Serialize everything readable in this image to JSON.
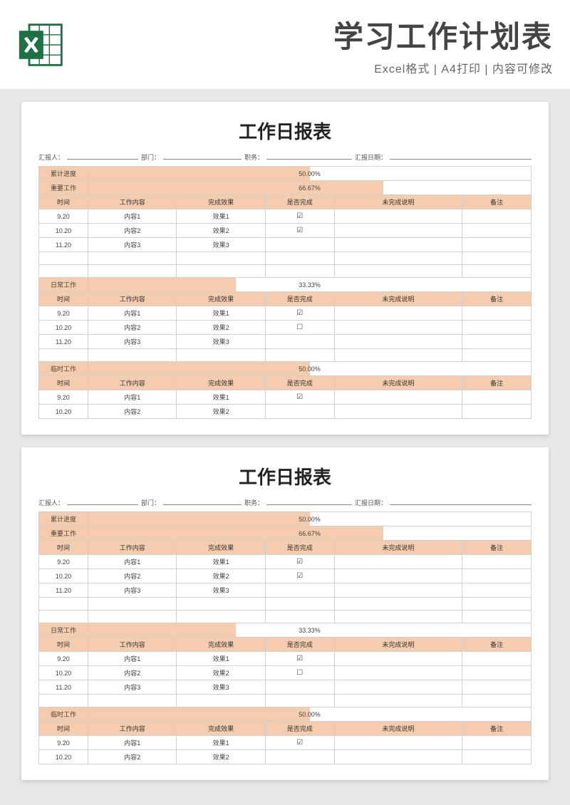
{
  "header": {
    "title": "学习工作计划表",
    "subtitle": "Excel格式 | A4打印 | 内容可修改"
  },
  "doc": {
    "title": "工作日报表",
    "info": {
      "reporter_label": "汇报人：",
      "dept_label": "部门：",
      "position_label": "职务：",
      "date_label": "汇报日期："
    },
    "labels": {
      "cumulative": "累计进度",
      "important": "重要工作",
      "daily": "日常工作",
      "temp": "临时工作",
      "time": "时间",
      "content": "工作内容",
      "effect": "完成效果",
      "done": "是否完成",
      "reason": "未完成说明",
      "note": "备注"
    },
    "progress": {
      "cumulative": "50.00%",
      "important": "66.67%",
      "daily": "33.33%",
      "temp": "50.00%"
    },
    "important_rows": [
      {
        "time": "9.20",
        "content": "内容1",
        "effect": "效果1",
        "done": "☑"
      },
      {
        "time": "10.20",
        "content": "内容2",
        "effect": "效果2",
        "done": "☑"
      },
      {
        "time": "11.20",
        "content": "内容3",
        "effect": "效果3",
        "done": ""
      }
    ],
    "daily_rows": [
      {
        "time": "9.20",
        "content": "内容1",
        "effect": "效果1",
        "done": "☑"
      },
      {
        "time": "10.20",
        "content": "内容2",
        "effect": "效果2",
        "done": "☐"
      },
      {
        "time": "11.20",
        "content": "内容3",
        "effect": "效果3",
        "done": ""
      }
    ],
    "temp_rows": [
      {
        "time": "9.20",
        "content": "内容1",
        "effect": "效果1",
        "done": "☑"
      },
      {
        "time": "10.20",
        "content": "内容2",
        "effect": "效果2",
        "done": ""
      }
    ]
  }
}
